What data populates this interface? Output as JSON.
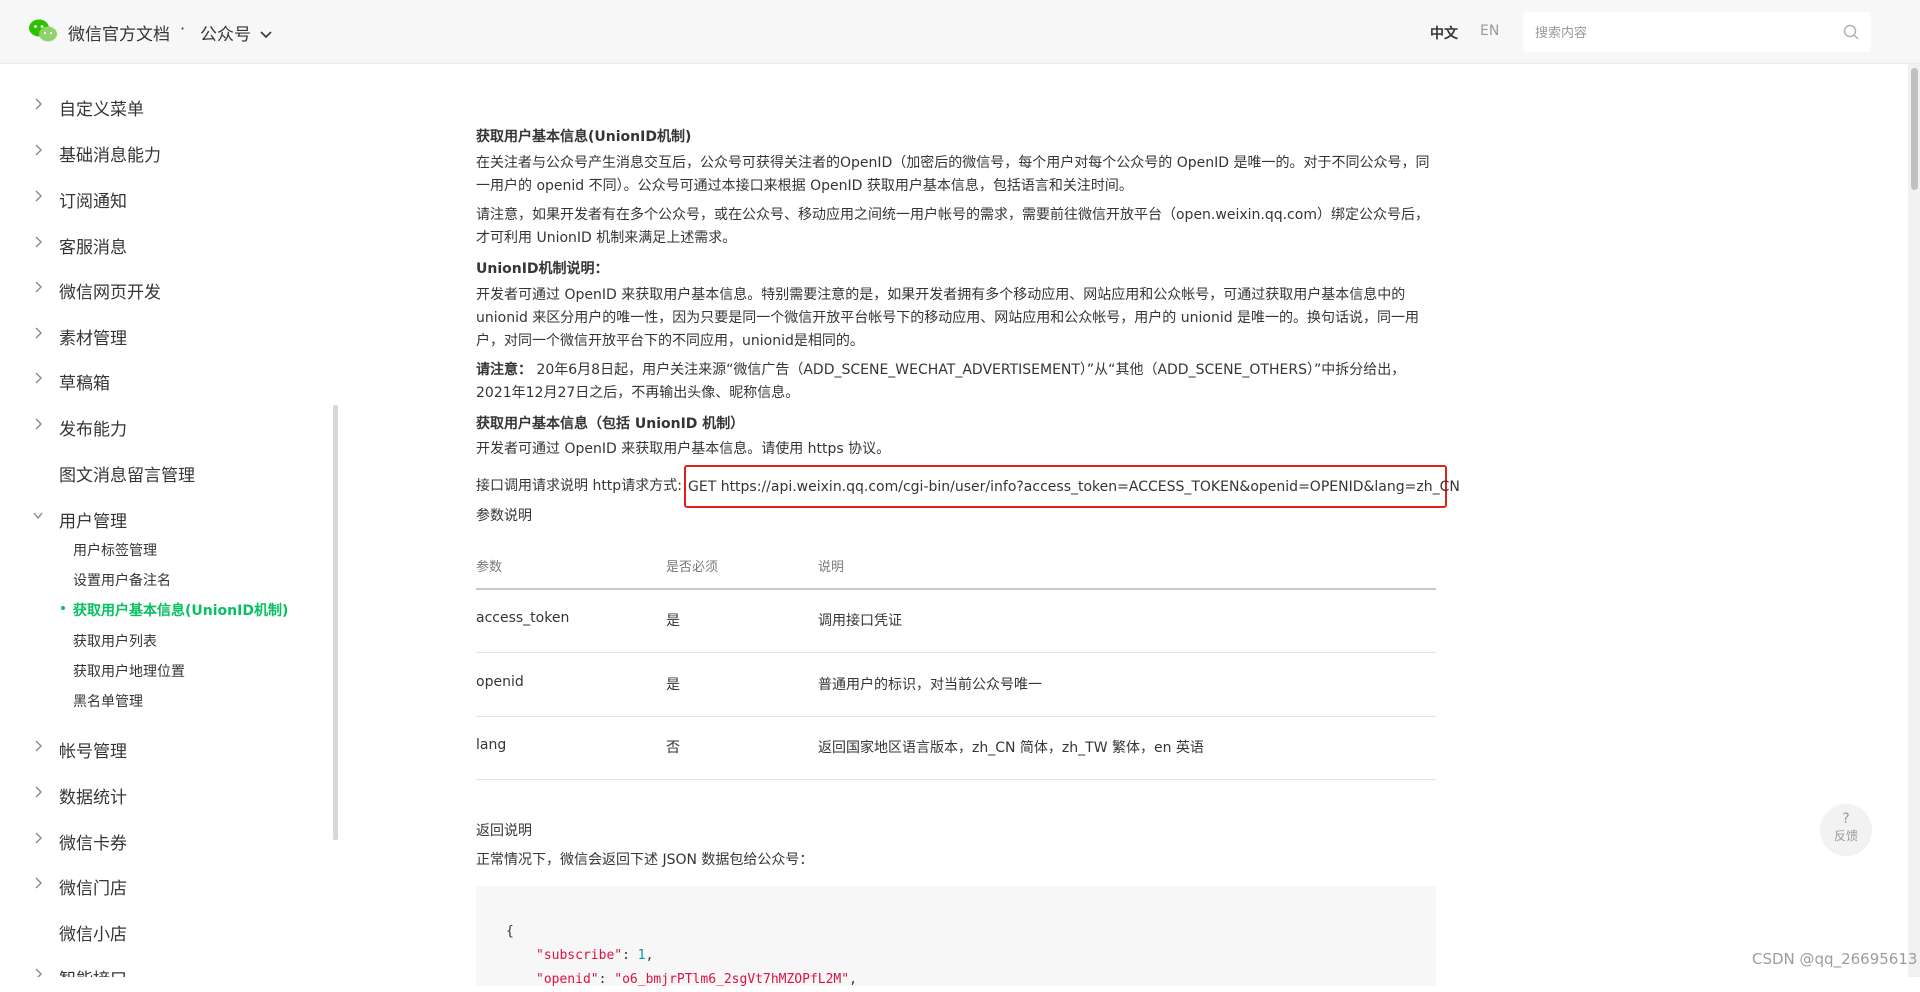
{
  "header": {
    "brand": "微信官方文档",
    "separator": "·",
    "section": "公众号",
    "lang_zh": "中文",
    "lang_en": "EN",
    "search_placeholder": "搜索内容"
  },
  "sidebar": {
    "items": [
      {
        "label": "自定义菜单",
        "expanded": false
      },
      {
        "label": "基础消息能力",
        "expanded": false
      },
      {
        "label": "订阅通知",
        "expanded": false
      },
      {
        "label": "客服消息",
        "expanded": false
      },
      {
        "label": "微信网页开发",
        "expanded": false
      },
      {
        "label": "素材管理",
        "expanded": false
      },
      {
        "label": "草稿箱",
        "expanded": false
      },
      {
        "label": "发布能力",
        "expanded": false
      },
      {
        "label": "图文消息留言管理",
        "expanded": false
      },
      {
        "label": "用户管理",
        "expanded": true
      },
      {
        "label": "帐号管理",
        "expanded": false
      },
      {
        "label": "数据统计",
        "expanded": false
      },
      {
        "label": "微信卡券",
        "expanded": false
      },
      {
        "label": "微信门店",
        "expanded": false
      },
      {
        "label": "微信小店",
        "expanded": false
      },
      {
        "label": "智能接口",
        "expanded": false
      }
    ],
    "sub_items": [
      "用户标签管理",
      "设置用户备注名",
      "获取用户基本信息(UnionID机制)",
      "获取用户列表",
      "获取用户地理位置",
      "黑名单管理"
    ],
    "active_sub": "获取用户基本信息(UnionID机制)"
  },
  "content": {
    "title": "获取用户基本信息(UnionID机制)",
    "p1": "在关注者与公众号产生消息交互后，公众号可获得关注者的OpenID（加密后的微信号，每个用户对每个公众号的 OpenID 是唯一的。对于不同公众号，同一用户的 openid 不同）。公众号可通过本接口来根据 OpenID 获取用户基本信息，包括语言和关注时间。",
    "p2": "请注意，如果开发者有在多个公众号，或在公众号、移动应用之间统一用户帐号的需求，需要前往微信开放平台（open.weixin.qq.com）绑定公众号后，才可利用 UnionID 机制来满足上述需求。",
    "unionid_heading": "UnionID机制说明：",
    "p3": "开发者可通过 OpenID 来获取用户基本信息。特别需要注意的是，如果开发者拥有多个移动应用、网站应用和公众帐号，可通过获取用户基本信息中的 unionid 来区分用户的唯一性，因为只要是同一个微信开放平台帐号下的移动应用、网站应用和公众帐号，用户的 unionid 是唯一的。换句话说，同一用户，对同一个微信开放平台下的不同应用，unionid是相同的。",
    "note_label": "请注意：",
    "note_text": " 20年6月8日起，用户关注来源“微信广告（ADD_SCENE_WECHAT_ADVERTISEMENT）”从“其他（ADD_SCENE_OTHERS）”中拆分给出，2021年12月27日之后，不再输出头像、昵称信息。",
    "sub_heading": "获取用户基本信息（包括 UnionID 机制）",
    "p4": "开发者可通过 OpenID 来获取用户基本信息。请使用 https 协议。",
    "request_label": "接口调用请求说明 http请求方式: ",
    "request_url": "GET https://api.weixin.qq.com/cgi-bin/user/info?access_token=ACCESS_TOKEN&openid=OPENID&lang=zh_CN",
    "params_label": "参数说明",
    "table": {
      "headers": [
        "参数",
        "是否必须",
        "说明"
      ],
      "rows": [
        [
          "access_token",
          "是",
          "调用接口凭证"
        ],
        [
          "openid",
          "是",
          "普通用户的标识，对当前公众号唯一"
        ],
        [
          "lang",
          "否",
          "返回国家地区语言版本，zh_CN 简体，zh_TW 繁体，en 英语"
        ]
      ]
    },
    "return_label": "返回说明",
    "return_desc": "正常情况下，微信会返回下述 JSON 数据包给公众号：",
    "code": {
      "open": "{",
      "k1": "\"subscribe\"",
      "v1": "1",
      "k2": "\"openid\"",
      "v2": "\"o6_bmjrPTlm6_2sgVt7hMZOPfL2M\""
    }
  },
  "feedback": {
    "icon": "?",
    "label": "反馈"
  },
  "watermark": "CSDN @qq_26695613",
  "colors": {
    "accent_green": "#07c160",
    "highlight_red": "#e0211b"
  }
}
